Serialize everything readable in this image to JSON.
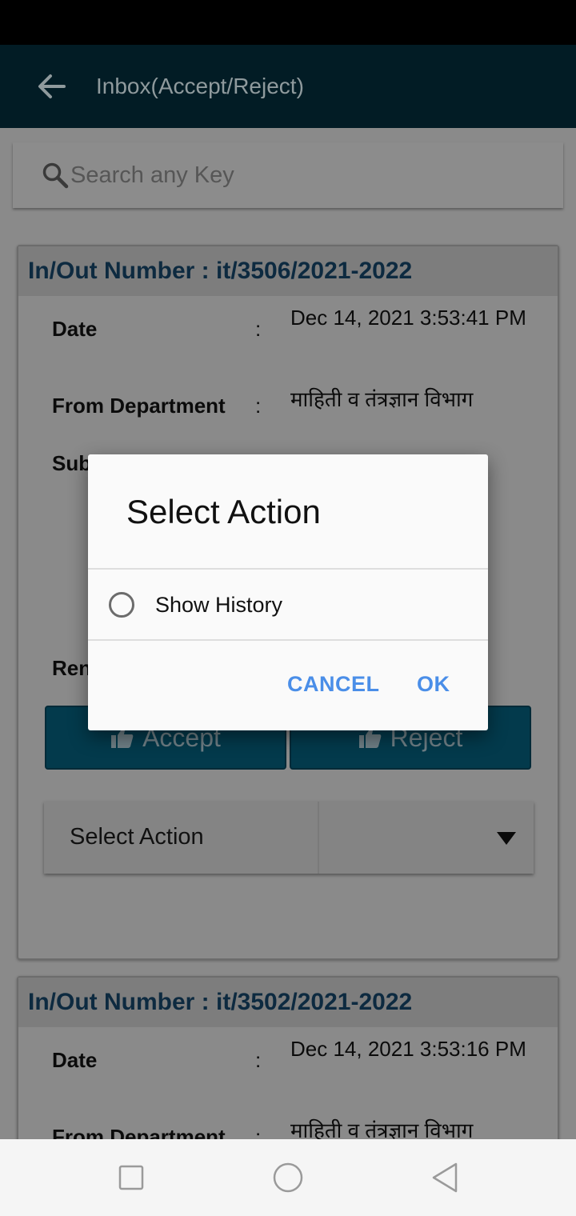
{
  "app_bar": {
    "title": "Inbox(Accept/Reject)"
  },
  "search": {
    "placeholder": "Search any Key"
  },
  "cards": [
    {
      "number": "In/Out Number : it/3506/2021-2022",
      "date_label": "Date",
      "date_value": "Dec 14, 2021 3:53:41 PM",
      "from_label": "From Department",
      "from_value": "माहिती व तंत्रज्ञान विभाग",
      "subject_label": "Sub",
      "remarks_label": "Ren",
      "accept_label": "Accept",
      "reject_label": "Reject",
      "select_label": "Select Action"
    },
    {
      "number": "In/Out Number : it/3502/2021-2022",
      "date_label": "Date",
      "date_value": "Dec 14, 2021 3:53:16 PM",
      "from_label": "From Department",
      "from_value": "माहिती व तंत्रज्ञान विभाग"
    }
  ],
  "colon": ":",
  "dialog": {
    "title": "Select Action",
    "option": "Show History",
    "cancel": "CANCEL",
    "ok": "OK"
  },
  "icons": {
    "back": "arrow-left-icon",
    "search": "search-icon",
    "thumb": "thumb-up-icon",
    "dropdown": "triangle-down-icon",
    "recents": "square-icon",
    "home": "circle-icon",
    "back_nav": "triangle-left-icon"
  },
  "colors": {
    "app_bar": "#021c25",
    "accent": "#4a8ee8",
    "button": "#033a4c"
  }
}
